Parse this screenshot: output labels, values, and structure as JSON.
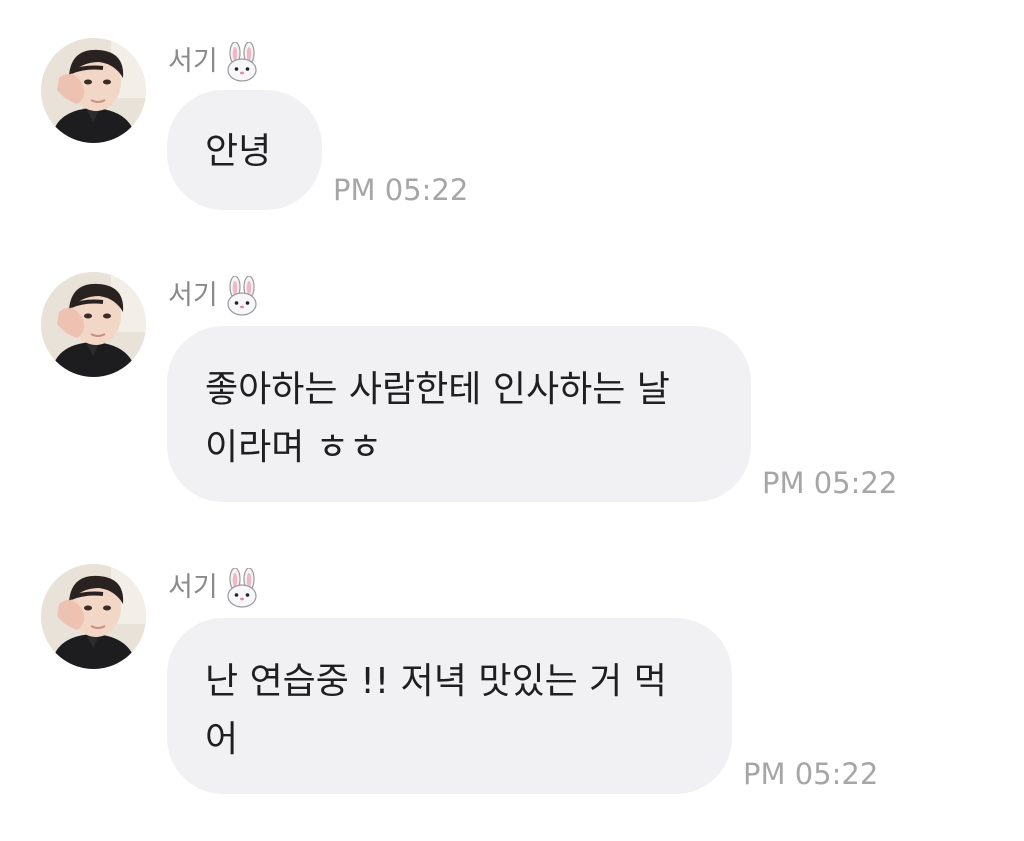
{
  "messages": [
    {
      "sender": "서기",
      "sender_emoji": "rabbit-face-icon",
      "lines": [
        "안녕"
      ],
      "time": "PM 05:22"
    },
    {
      "sender": "서기",
      "sender_emoji": "rabbit-face-icon",
      "lines": [
        "좋아하는 사람한테 인사하는 날",
        "이라며 ㅎㅎ"
      ],
      "time": "PM 05:22"
    },
    {
      "sender": "서기",
      "sender_emoji": "rabbit-face-icon",
      "lines": [
        "난 연습중 !! 저녁 맛있는 거 먹",
        "어"
      ],
      "time": "PM 05:22"
    }
  ],
  "colors": {
    "bubble": "#f1f1f4",
    "sender_name": "#8a8a8a",
    "timestamp": "#a6a6a6",
    "message_text": "#1f1f1f"
  }
}
